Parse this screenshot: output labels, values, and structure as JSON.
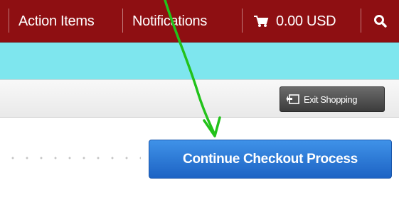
{
  "nav": {
    "action_items": "Action Items",
    "notifications": "Notifications",
    "cart_total": "0.00 USD",
    "cart_icon": "cart-icon",
    "search_icon": "search-icon"
  },
  "toolbar": {
    "exit_label": "Exit Shopping",
    "exit_icon": "exit-icon"
  },
  "main": {
    "checkout_label": "Continue Checkout Process"
  },
  "colors": {
    "nav_bg": "#8e0f12",
    "band_bg": "#7ee6ee",
    "checkout_bg": "#2a79d6",
    "annotation_arrow": "#22c21a"
  }
}
